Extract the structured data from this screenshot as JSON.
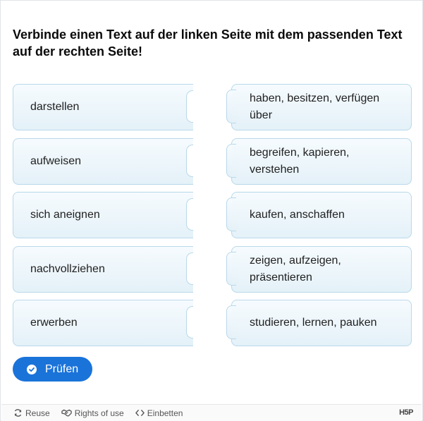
{
  "task": {
    "instruction": "Verbinde einen Text auf der linken Seite mit dem passenden Text auf der rechten Seite!"
  },
  "left_items": [
    {
      "label": "darstellen"
    },
    {
      "label": "aufweisen"
    },
    {
      "label": "sich aneignen"
    },
    {
      "label": "nachvollziehen"
    },
    {
      "label": "erwerben"
    }
  ],
  "right_items": [
    {
      "label": "haben, besitzen, verfügen über"
    },
    {
      "label": "begreifen, kapieren, verstehen"
    },
    {
      "label": "kaufen, anschaffen"
    },
    {
      "label": "zeigen, aufzeigen, präsentieren"
    },
    {
      "label": "studieren, lernen, pauken"
    }
  ],
  "check_button": {
    "label": "Prüfen",
    "icon": "check-circle-icon",
    "color": "#1a73d9"
  },
  "footer": {
    "reuse": {
      "label": "Reuse",
      "icon": "reuse-icon"
    },
    "rights": {
      "label": "Rights of use",
      "icon": "handshake-icon"
    },
    "embed": {
      "label": "Einbetten",
      "icon": "code-icon"
    },
    "brand": "H5P"
  }
}
